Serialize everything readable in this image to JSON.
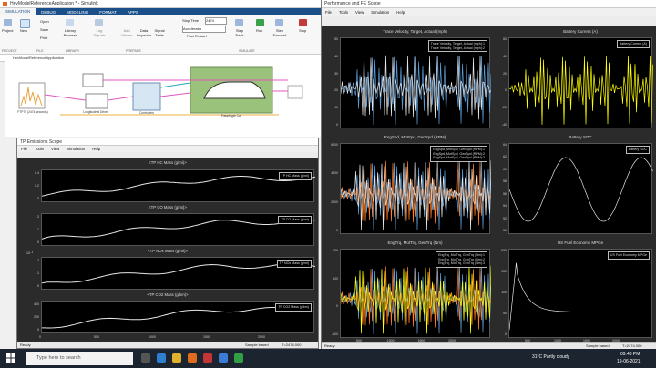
{
  "simulink": {
    "title": "HevModelReferenceApplication * - Simulink",
    "tabs": [
      "SIMULATION",
      "DEBUG",
      "MODELING",
      "FORMAT",
      "APPS"
    ],
    "ribbon": {
      "new_label": "New",
      "open_label": "Open",
      "save_label": "Save",
      "print_label": "Print",
      "project_label": "Project",
      "library_label": "Library Browser",
      "log_label": "Log Signals",
      "add_viewer_label": "Add Viewer",
      "data_inspector_label": "Data Inspector",
      "signal_table_label": "Signal Table",
      "stop_time_label": "Stop Time",
      "stop_time_value": "2474",
      "mode_value": "Accelerator",
      "fast_restart_label": "Fast Restart",
      "step_back_label": "Step Back",
      "run_label": "Run",
      "step_forward_label": "Step Forward",
      "stop_label": "Stop",
      "sections": [
        "PROJECT",
        "FILE",
        "LIBRARY",
        "PREPARE",
        "SIMULATE"
      ]
    },
    "breadcrumb": "HevModelReferenceApplication",
    "blocks": {
      "controllers": "Controllers",
      "longitudinal": "Longitudinal Driver",
      "passenger": "Passenger Car",
      "cycle": "FTP75 (2474 seconds)"
    }
  },
  "emissions": {
    "title": "TP Emissions Scope",
    "menu": [
      "File",
      "Tools",
      "View",
      "Simulation",
      "Help"
    ],
    "plots": [
      {
        "title": "<TP HC Mass (g/mi)>",
        "legend": "TP HC Mass (g/mi)",
        "yticks": [
          "0.4",
          "0.2",
          "0"
        ]
      },
      {
        "title": "<TP CO Mass (g/mi)>",
        "legend": "TP CO Mass (g/mi)",
        "yticks": [
          "2",
          "1",
          "0"
        ]
      },
      {
        "title": "<TP NOx Mass (g/mi)>",
        "legend": "TP NOx Mass (g/mi)",
        "yticks": [
          "2",
          "1",
          "0"
        ],
        "exp": "10⁻³"
      },
      {
        "title": "<TP CO2 Mass (g/km)>",
        "legend": "TP CO2 Mass (g/km)",
        "yticks": [
          "400",
          "200",
          "0"
        ]
      }
    ],
    "xticks": [
      "0",
      "500",
      "1000",
      "1500",
      "2000"
    ],
    "status_left": "Ready",
    "status_mid": "Sample based",
    "status_right": "T=2474.000"
  },
  "pfe": {
    "title": "Performance and FE Scope",
    "menu": [
      "File",
      "Tools",
      "View",
      "Simulation",
      "Help"
    ],
    "plots": [
      {
        "title": "Trace Velocity, Target, Actual (mph)",
        "legend": [
          "Trace Velocity, Target, Actual (mph):1",
          "Trace Velocity, Target, Actual (mph):2"
        ],
        "yticks": [
          "50",
          "40",
          "30",
          "20",
          "10",
          "0"
        ]
      },
      {
        "title": "Battery Current (A)",
        "legend": [
          "Battery Current (A)"
        ],
        "yticks": [
          "60",
          "40",
          "20",
          "0",
          "-20",
          "-40"
        ]
      },
      {
        "title": "EngSpd, MotSpd, GenSpd (RPM)",
        "legend": [
          "EngSpd, MotSpd, GenSpd (RPM):1",
          "EngSpd, MotSpd, GenSpd (RPM):2",
          "EngSpd, MotSpd, GenSpd (RPM):3"
        ],
        "yticks": [
          "6000",
          "4000",
          "2000",
          "0"
        ]
      },
      {
        "title": "Battery SOC",
        "legend": [
          "Battery SOC"
        ],
        "yticks": [
          "64",
          "62",
          "60",
          "58",
          "56",
          "54",
          "52",
          "50"
        ]
      },
      {
        "title": "EngTrq, MotTrq, GenTrq (Nm)",
        "legend": [
          "EngTrq, MotTrq, GenTrq (Nm):1",
          "EngTrq, MotTrq, GenTrq (Nm):2",
          "EngTrq, MotTrq, GenTrq (Nm):3"
        ],
        "yticks": [
          "200",
          "100",
          "0",
          "-100"
        ]
      },
      {
        "title": "US Fuel Economy MPGe",
        "legend": [
          "US Fuel Economy MPGe"
        ],
        "yticks": [
          "200",
          "150",
          "100",
          "50",
          "0"
        ]
      }
    ],
    "xticks": [
      "500",
      "1000",
      "1500",
      "2000"
    ],
    "status_left": "Ready",
    "status_mid": "Sample based",
    "status_right": "T=2474.000"
  },
  "taskbar": {
    "search_placeholder": "Type here to search",
    "weather": "31°C  Partly cloudy",
    "time": "09:48 PM",
    "date": "19-06-2021"
  },
  "colors": {
    "ribbon_blue": "#1b4f8a",
    "trace_blue": "#5b9bd5",
    "trace_yellow": "#ffff00",
    "trace_orange": "#ff7f27",
    "trace_white": "#e6e6e6",
    "taskbar": "#1c2430"
  }
}
